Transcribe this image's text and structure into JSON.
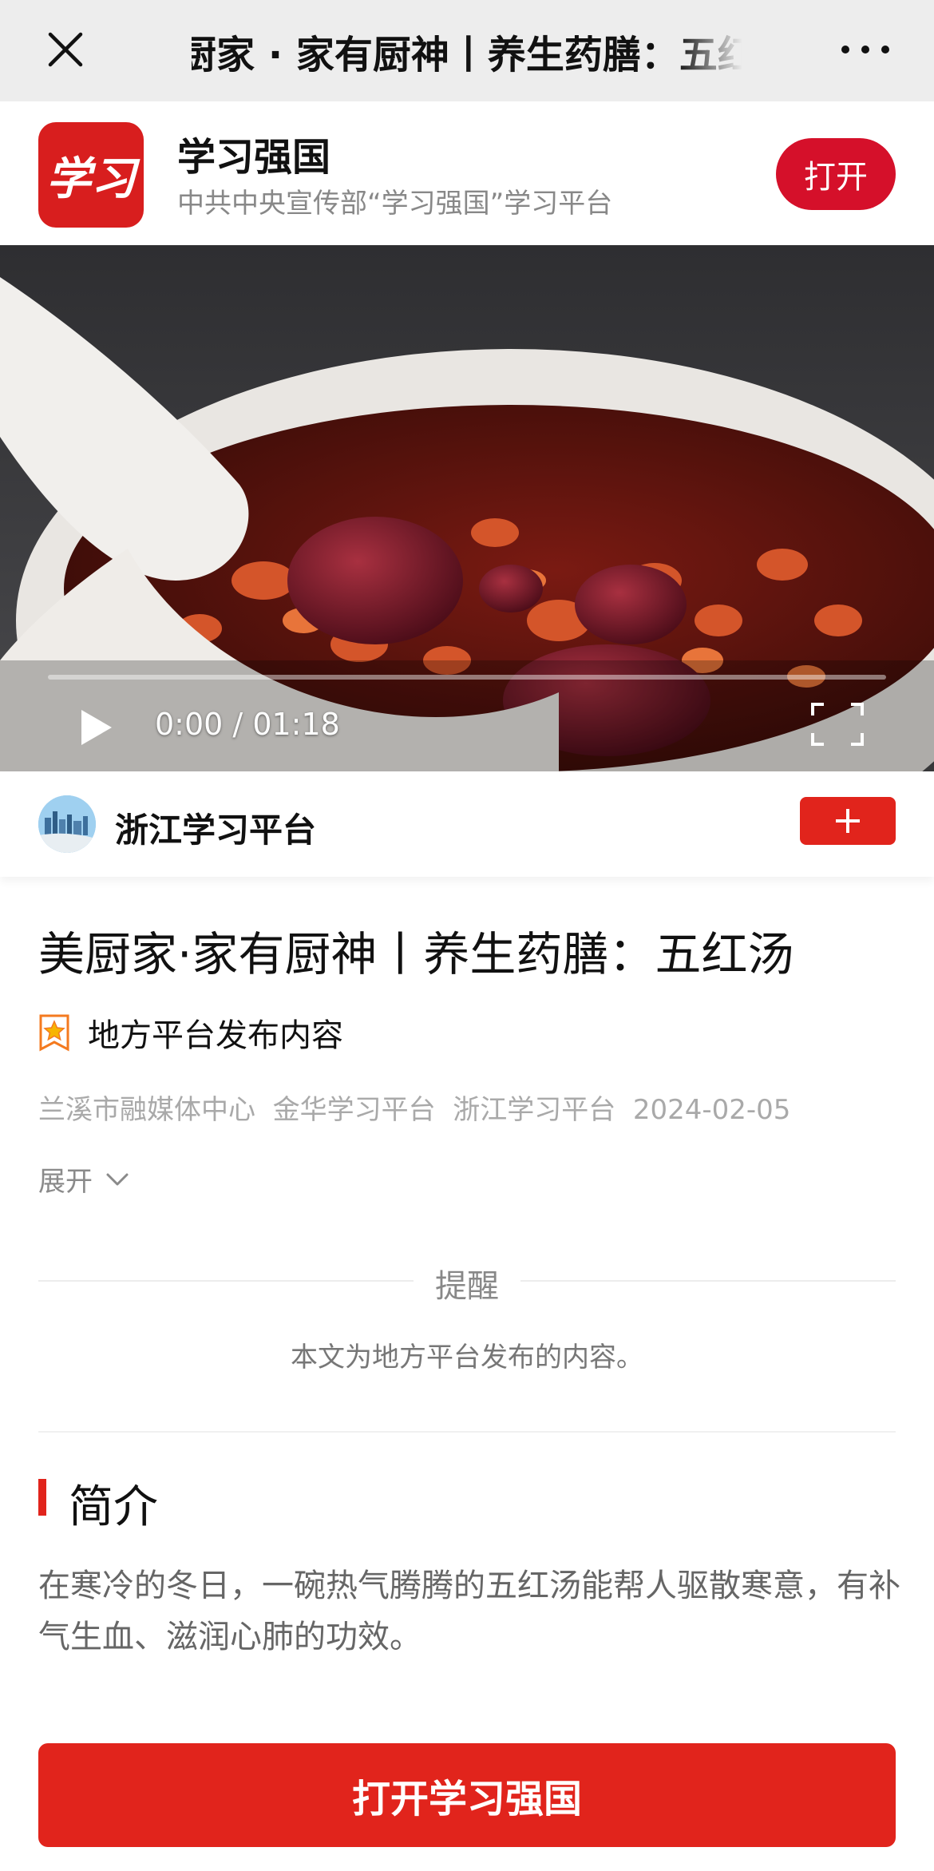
{
  "navbar": {
    "title": "美厨家 · 家有厨神丨养生药膳：五红汤",
    "close_icon": "close-icon",
    "more_icon": "more-icon"
  },
  "app_banner": {
    "logo_text": "学习",
    "name": "学习强国",
    "description": "中共中央宣传部“学习强国”学习平台",
    "open_label": "打开",
    "brand_color": "#d5102a"
  },
  "video": {
    "current_time": "0:00",
    "separator": " / ",
    "duration": "01:18",
    "progress": 0.0,
    "play_icon": "play-icon",
    "fullscreen_icon": "fullscreen-icon"
  },
  "channel": {
    "name": "浙江学习平台",
    "follow_icon": "plus-icon",
    "accent_color": "#e1241c"
  },
  "article": {
    "title": "美厨家·家有厨神丨养生药膳：五红汤",
    "source_tag": "地方平台发布内容",
    "byline": "兰溪市融媒体中心  金华学习平台  浙江学习平台  2024-02-05",
    "expand_label": "展开"
  },
  "reminder": {
    "title": "提醒",
    "body": "本文为地方平台发布的内容。"
  },
  "intro": {
    "heading": "简介",
    "body": "在寒冷的冬日，一碗热气腾腾的五红汤能帮人驱散寒意，有补气生血、滋润心肺的功效。"
  },
  "cta": {
    "label": "打开学习强国"
  }
}
